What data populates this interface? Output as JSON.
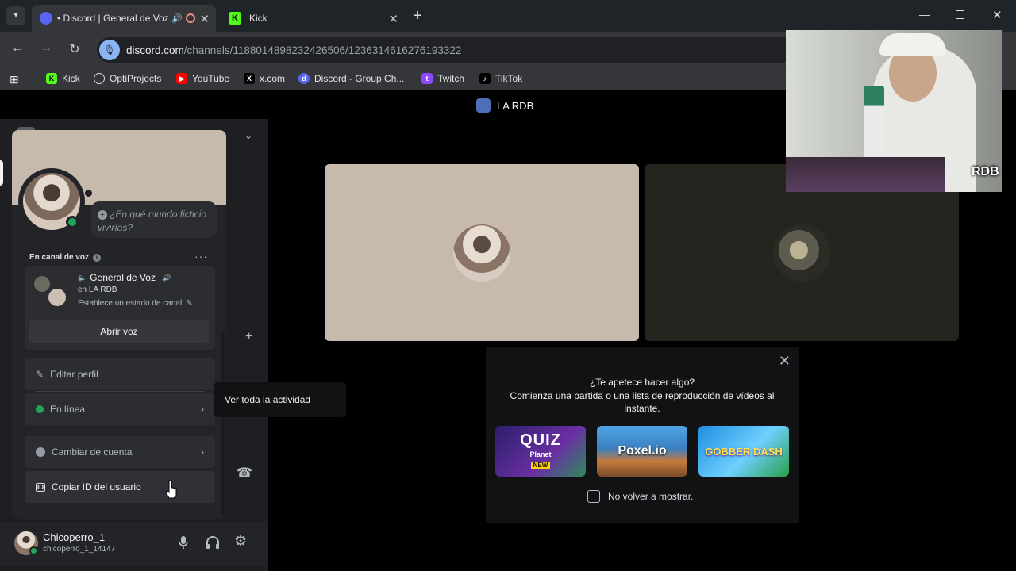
{
  "browser": {
    "tabs": [
      {
        "title": "• Discord | General de Voz",
        "active": true
      },
      {
        "title": "Kick",
        "active": false
      }
    ],
    "url": {
      "domain": "discord.com",
      "path": "/channels/1188014898232426506/1236314616276193322"
    },
    "bookmarks": [
      "Kick",
      "OptiProjects",
      "YouTube",
      "x.com",
      "Discord - Group Ch...",
      "Twitch",
      "TikTok"
    ]
  },
  "server": {
    "name": "LA RDB"
  },
  "profile": {
    "status_placeholder": "¿En qué mundo ficticio vivirías?",
    "voice_section_label": "En canal de voz",
    "voice_channel": "General de Voz",
    "voice_server": "en LA RDB",
    "voice_status": "Establece un estado de canal",
    "open_voice_button": "Abrir voz",
    "menu": {
      "edit_profile": "Editar perfil",
      "online": "En línea",
      "switch_account": "Cambiar de cuenta",
      "copy_id": "Copiar ID del usuario"
    }
  },
  "tooltip": {
    "text": "Ver toda la actividad"
  },
  "user": {
    "display_name": "Chicoperro_1",
    "username": "chicoperro_1_14147"
  },
  "activity_popup": {
    "title": "¿Te apetece hacer algo?",
    "subtitle": "Comienza una partida o una lista de reproducción de vídeos al instante.",
    "games": [
      "QUIZ",
      "Poxel.io",
      "GOBBER DASH"
    ],
    "quiz_sub": "Planet",
    "quiz_badge": "NEW",
    "checkbox_label": "No volver a mostrar."
  },
  "webcam": {
    "overlay_logo": "RDB"
  },
  "colors": {
    "online": "#23a55a",
    "discord_blurple": "#5865f2",
    "kick_green": "#53fc18"
  }
}
